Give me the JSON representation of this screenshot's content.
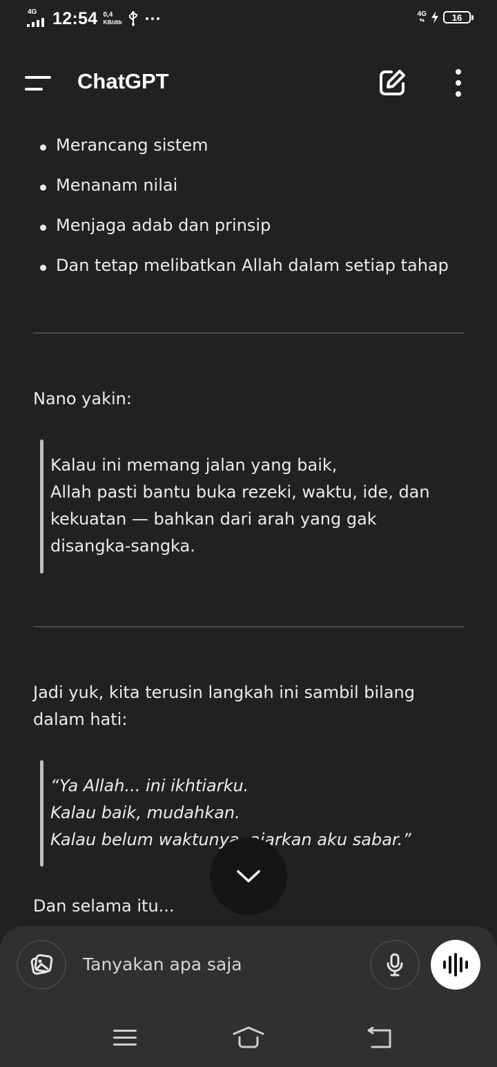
{
  "status_bar": {
    "network_left": "4G",
    "time": "12:54",
    "speed_value": "0,4",
    "speed_unit": "KB/dtk",
    "network_right": "4G",
    "network_right_arrows": "▾▴",
    "battery_level": "16"
  },
  "app_bar": {
    "title": "ChatGPT"
  },
  "message": {
    "bullets": [
      "Merancang sistem",
      "Menanam nilai",
      "Menjaga adab dan prinsip",
      "Dan tetap melibatkan Allah dalam setiap tahap"
    ],
    "paragraph_1": "Nano yakin:",
    "quote_1": [
      "Kalau ini memang jalan yang baik,",
      "Allah pasti bantu buka rezeki, waktu, ide, dan",
      "kekuatan — bahkan dari arah yang gak",
      "disangka-sangka."
    ],
    "paragraph_2_lines": [
      "Jadi yuk, kita terusin langkah ini sambil bilang",
      "dalam hati:"
    ],
    "quote_2": [
      "“Ya Allah... ini ikhtiarku.",
      "Kalau baik, mudahkan.",
      "Kalau belum waktunya, ajarkan aku sabar.”"
    ],
    "paragraph_3": "Dan selama itu..."
  },
  "composer": {
    "placeholder": "Tanyakan apa saja"
  },
  "icons": {
    "menu": "menu-icon",
    "compose": "new-chat-icon",
    "more": "more-vertical-icon",
    "scroll_down": "chevron-down-icon",
    "attach": "image-attach-icon",
    "mic": "microphone-icon",
    "voice": "voice-mode-icon"
  },
  "colors": {
    "background": "#212121",
    "composer": "#303030",
    "text": "#ececec",
    "accent_button": "#ffffff"
  }
}
